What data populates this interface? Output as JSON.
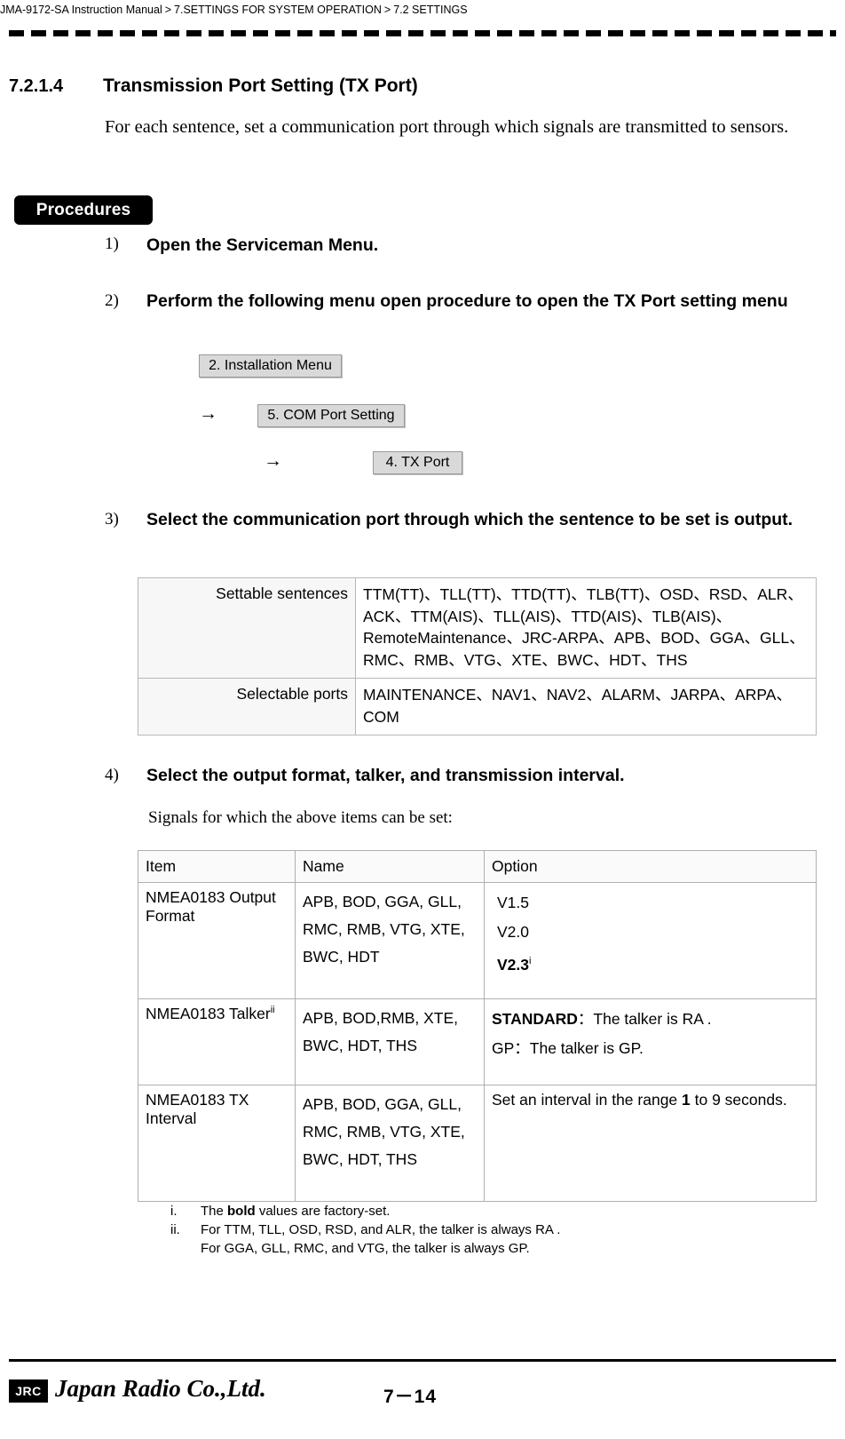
{
  "header": {
    "manual": "JMA-9172-SA Instruction Manual",
    "sep1": ">",
    "crumb1": "7.SETTINGS FOR SYSTEM OPERATION",
    "sep2": ">",
    "crumb2": "7.2  SETTINGS"
  },
  "section": {
    "number": "7.2.1.4",
    "title": "Transmission Port Setting (TX Port)",
    "intro": "For each sentence, set a communication port through which signals are transmitted to sensors."
  },
  "procedures": {
    "badge": "Procedures",
    "steps": [
      {
        "num": "1)",
        "text": "Open the Serviceman Menu."
      },
      {
        "num": "2)",
        "text": "Perform the following menu open procedure to open the TX Port setting menu"
      },
      {
        "num": "3)",
        "text": "Select the communication port through which the sentence to be set is output."
      },
      {
        "num": "4)",
        "text": "Select the output format, talker, and transmission interval."
      }
    ],
    "menu_path": {
      "box1": "2. Installation Menu",
      "arrow1": "→",
      "box2": "5. COM Port Setting",
      "arrow2": "→",
      "box3": "4. TX Port"
    }
  },
  "settable_table": {
    "rows": [
      {
        "label": "Settable sentences",
        "value": "TTM(TT)、TLL(TT)、TTD(TT)、TLB(TT)、OSD、RSD、ALR、ACK、TTM(AIS)、TLL(AIS)、TTD(AIS)、TLB(AIS)、RemoteMaintenance、JRC-ARPA、APB、BOD、GGA、GLL、RMC、RMB、VTG、XTE、BWC、HDT、THS"
      },
      {
        "label": "Selectable ports",
        "value": "MAINTENANCE、NAV1、NAV2、ALARM、JARPA、ARPA、COM"
      }
    ]
  },
  "signals_note": "Signals for which the above items can be set:",
  "main_table": {
    "headers": [
      "Item",
      "Name",
      "Option"
    ],
    "rows": [
      {
        "item": "NMEA0183 Output Format",
        "name": "APB, BOD, GGA, GLL, RMC, RMB, VTG, XTE,    BWC, HDT",
        "option_lines": [
          "V1.5",
          "V2.0",
          "V2.3"
        ],
        "option_bold_index": 2,
        "option_sup": "i"
      },
      {
        "item": "NMEA0183 Talker",
        "item_sup": "ii",
        "name": "APB, BOD,RMB, XTE, BWC, HDT, THS",
        "option_lines": [
          "STANDARD：The talker is RA .",
          "GP：The talker is GP."
        ],
        "option_bold_prefix": [
          "STANDARD",
          ""
        ]
      },
      {
        "item": "NMEA0183 TX Interval",
        "name": "APB, BOD, GGA, GLL, RMC, RMB, VTG, XTE, BWC, HDT, THS",
        "option_text_pre": "Set an interval in the range ",
        "option_text_bold": "1",
        "option_text_post": " to 9 seconds."
      }
    ]
  },
  "footnotes": [
    {
      "mark": "i.",
      "pre": "The ",
      "bold": "bold",
      "post": " values are factory-set."
    },
    {
      "mark": "ii.",
      "line1": "For TTM, TLL, OSD, RSD, and ALR, the talker is always RA .",
      "line2": "For GGA, GLL, RMC, and VTG, the talker is always GP."
    }
  ],
  "footer": {
    "logo": "JRC",
    "company": "Japan Radio Co.,Ltd.",
    "page": "7－14"
  }
}
